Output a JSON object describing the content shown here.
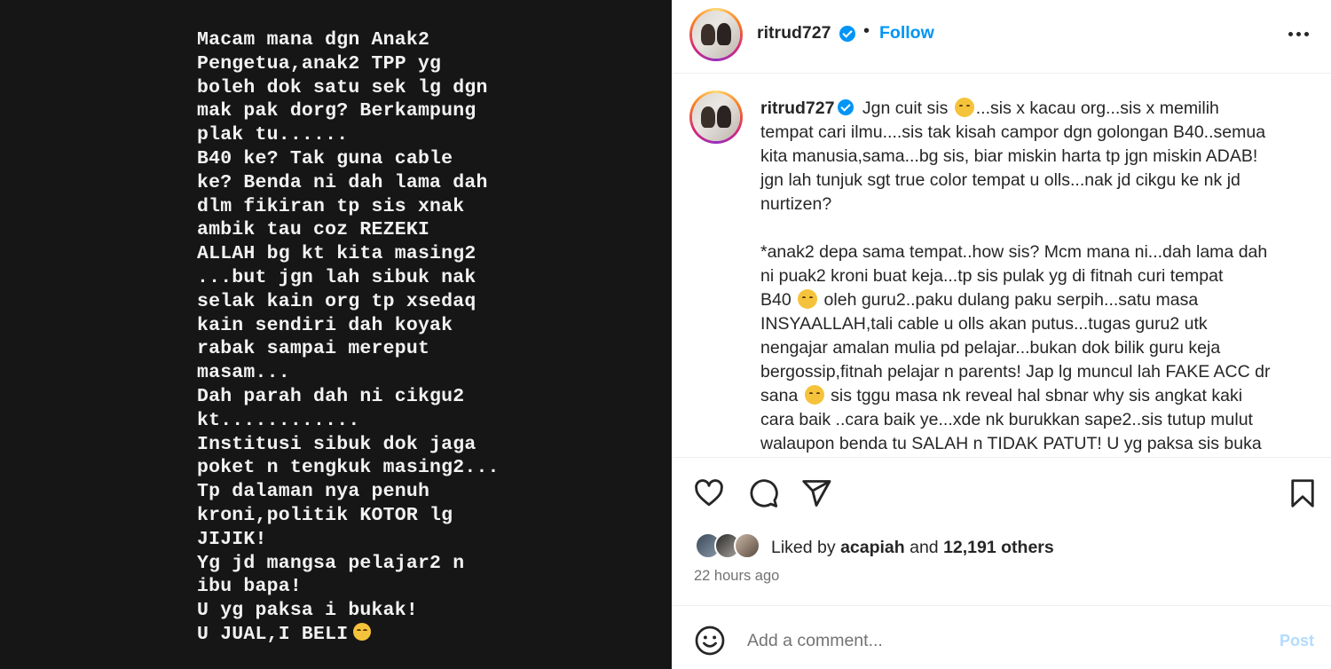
{
  "media": {
    "lines": [
      "Macam mana dgn Anak2",
      "Pengetua,anak2 TPP yg",
      "boleh dok satu sek lg dgn",
      "mak pak dorg? Berkampung",
      "plak tu......",
      "B40 ke? Tak guna cable",
      "ke? Benda ni dah lama dah",
      "dlm fikiran tp sis xnak",
      "ambik tau coz REZEKI",
      "ALLAH bg kt kita masing2",
      "...but jgn lah sibuk nak",
      "selak kain org tp xsedaq",
      "kain sendiri dah koyak",
      "rabak sampai mereput",
      "masam...",
      "Dah parah dah ni cikgu2",
      "kt............",
      "Institusi sibuk dok jaga",
      "poket n tengkuk masing2...",
      "Tp dalaman nya penuh",
      "kroni,politik KOTOR lg",
      "JIJIK!",
      "Yg jd mangsa pelajar2 n",
      "ibu bapa!",
      "U yg paksa i bukak!",
      "U JUAL,I BELI"
    ],
    "last_line_emoji": "relieved-face-icon"
  },
  "header": {
    "username": "ritrud727",
    "separator": "•",
    "follow_label": "Follow"
  },
  "caption": {
    "username": "ritrud727",
    "line1_a": "Jgn cuit sis",
    "line1_b": "...sis x kacau org...sis x memilih",
    "lines_p1": [
      "tempat cari ilmu....sis tak kisah campor dgn golongan B40..semua",
      "kita manusia,sama...bg sis, biar miskin harta tp jgn miskin ADAB!",
      "jgn lah tunjuk sgt true color tempat u olls...nak jd cikgu ke nk jd",
      "nurtizen?"
    ],
    "lines_p2a": [
      "*anak2 depa sama tempat..how sis? Mcm mana ni...dah lama dah",
      "ni puak2 kroni buat keja...tp sis pulak yg di fitnah curi tempat"
    ],
    "line_b40_a": "B40",
    "line_b40_b": "oleh guru2..paku dulang paku serpih...satu masa",
    "lines_p2b": [
      "INSYAALLAH,tali cable u olls akan putus...tugas guru2 utk",
      "nengajar amalan mulia pd pelajar...bukan dok bilik guru keja",
      "bergossip,fitnah pelajar n parents! Jap lg muncul lah FAKE ACC dr"
    ],
    "line_sana_a": "sana",
    "line_sana_b": "sis tggu masa nk reveal hal sbnar why sis angkat kaki",
    "lines_p2c": [
      "cara baik ..cara baik ye...xde nk burukkan sape2..sis tutup mulut",
      "walaupon benda tu SALAH n TIDAK PATUT! U yg paksa sis buka"
    ]
  },
  "likes": {
    "prefix": "Liked by",
    "user": "acapiah",
    "and": "and",
    "others": "12,191 others"
  },
  "timestamp": "22 hours ago",
  "comment": {
    "placeholder": "Add a comment...",
    "post_label": "Post"
  },
  "colors": {
    "accent": "#0095f6",
    "media_bg": "#161616",
    "post_disabled": "#b3dbff"
  }
}
